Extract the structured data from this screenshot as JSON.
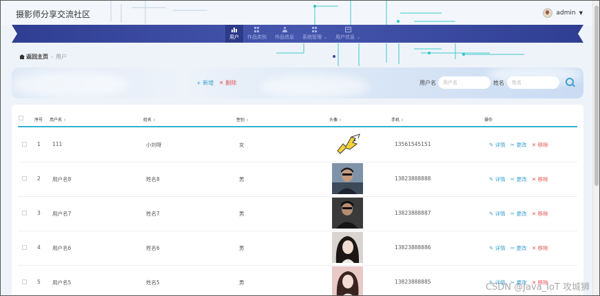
{
  "app": {
    "title": "摄影师分享交流社区",
    "user_name": "admin"
  },
  "nav": {
    "items": [
      {
        "label": "用户",
        "icon": "bar-chart-icon",
        "active": true
      },
      {
        "label": "作品类别",
        "icon": "grid-icon",
        "active": false
      },
      {
        "label": "作品信息",
        "icon": "user-icon",
        "active": false
      },
      {
        "label": "系统管理",
        "icon": "grid-icon",
        "active": false,
        "has_submenu": true
      },
      {
        "label": "用户信息",
        "icon": "card-icon",
        "active": false,
        "has_submenu": true
      }
    ]
  },
  "breadcrumb": {
    "home": "返回主页",
    "separator": "-",
    "current": "用户"
  },
  "search": {
    "add_label": "+ 新增",
    "delete_label": "✕ 删除",
    "username_label": "用户名",
    "username_placeholder": "用户名",
    "name_label": "姓名",
    "name_placeholder": "姓名"
  },
  "table": {
    "columns": {
      "index": "序号",
      "username": "用户名",
      "name": "姓名",
      "gender": "性别",
      "avatar": "头像",
      "phone": "手机",
      "actions": "操作"
    },
    "sort_glyph": "⇕",
    "actions": {
      "detail": "✎ 详情",
      "edit": "✂ 更改",
      "remove": "✕ 移除"
    },
    "rows": [
      {
        "index": "1",
        "username": "111",
        "name": "小刘呀",
        "gender": "女",
        "phone": "13561545151"
      },
      {
        "index": "2",
        "username": "用户名8",
        "name": "姓名8",
        "gender": "男",
        "phone": "13823888888"
      },
      {
        "index": "3",
        "username": "用户名7",
        "name": "姓名7",
        "gender": "男",
        "phone": "13823888887"
      },
      {
        "index": "4",
        "username": "用户名6",
        "name": "姓名6",
        "gender": "男",
        "phone": "13823888886"
      },
      {
        "index": "5",
        "username": "用户名5",
        "name": "姓名5",
        "gender": "男",
        "phone": "13823888885"
      }
    ]
  },
  "watermark": "CSDN @Java_IoT 攻城狮",
  "colors": {
    "nav_bg": "#3a4aa0",
    "nav_active": "#2c3a8a",
    "accent": "#39a0d0",
    "danger": "#e25555",
    "header_line": "#2fb2d3",
    "circuit": "#2bc4c8"
  }
}
